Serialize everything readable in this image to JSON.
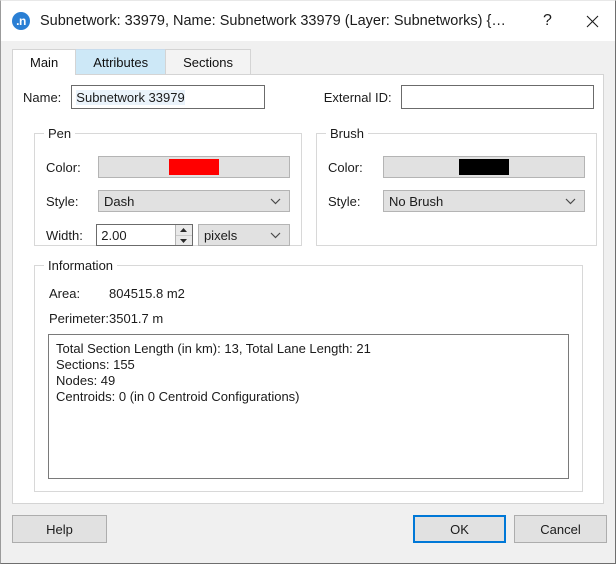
{
  "window": {
    "title": "Subnetwork: 33979, Name: Subnetwork 33979 (Layer: Subnetworks) {…",
    "icon": "app-logo-icon",
    "help_button": "?",
    "close_button": "×"
  },
  "tabs": [
    {
      "label": "Main",
      "state": "active"
    },
    {
      "label": "Attributes",
      "state": "hovered"
    },
    {
      "label": "Sections",
      "state": "normal"
    }
  ],
  "main": {
    "name": {
      "label": "Name:",
      "value": "Subnetwork 33979",
      "placeholder": ""
    },
    "external_id": {
      "label": "External ID:",
      "value": "",
      "placeholder": ""
    },
    "pen": {
      "legend": "Pen",
      "color_label": "Color:",
      "color_value": "#ff0000",
      "style_label": "Style:",
      "style_value": "Dash",
      "width_label": "Width:",
      "width_value": "2.00",
      "units_value": "pixels"
    },
    "brush": {
      "legend": "Brush",
      "color_label": "Color:",
      "color_value": "#000000",
      "style_label": "Style:",
      "style_value": "No Brush"
    },
    "information": {
      "legend": "Information",
      "area_label": "Area:",
      "area_value": "804515.8 m2",
      "perimeter_label": "Perimeter:",
      "perimeter_value": "3501.7 m",
      "details": "Total Section Length (in km): 13, Total Lane Length: 21\nSections: 155\nNodes: 49\nCentroids: 0 (in 0 Centroid Configurations)"
    }
  },
  "footer": {
    "help": "Help",
    "ok": "OK",
    "cancel": "Cancel"
  },
  "colors": {
    "accent": "#0078d7",
    "tab_hover": "#cde8f7",
    "button_face": "#e1e1e1",
    "panel": "#ffffff",
    "window_bg": "#f0f0f0"
  }
}
